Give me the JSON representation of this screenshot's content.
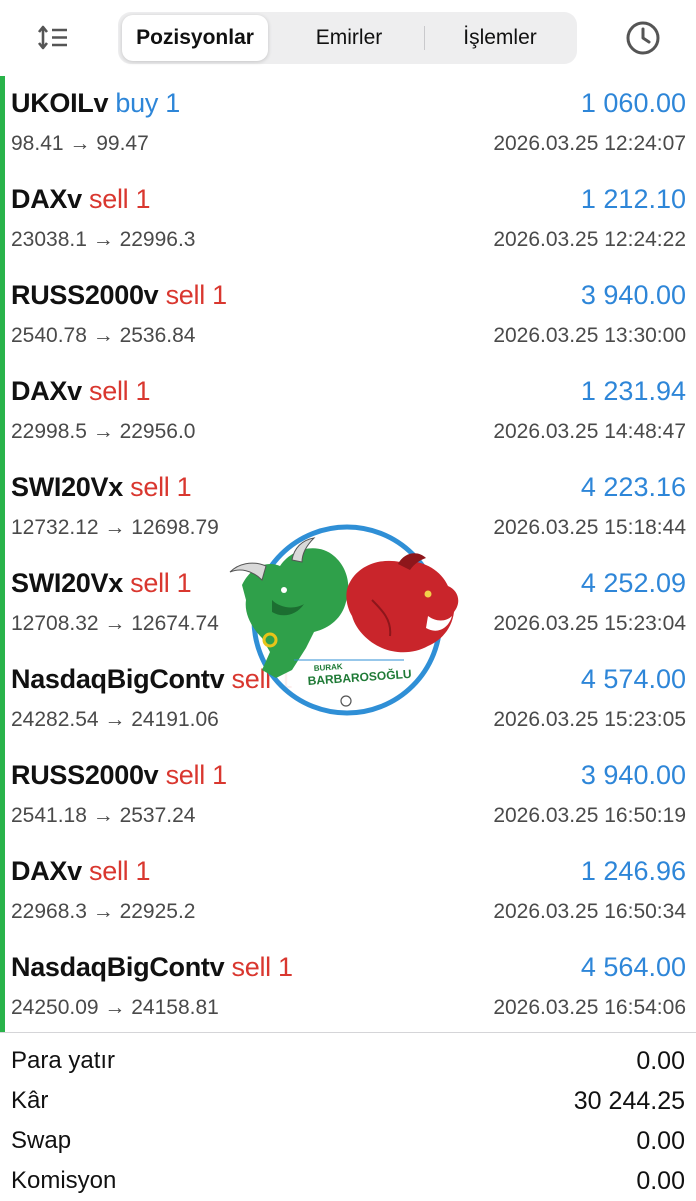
{
  "header": {
    "sort_icon": "sort-lines-icon",
    "tabs": [
      {
        "label": "Pozisyonlar",
        "active": true
      },
      {
        "label": "Emirler",
        "active": false
      },
      {
        "label": "İşlemler",
        "active": false
      }
    ],
    "history_icon": "clock-icon"
  },
  "positions": [
    {
      "symbol": "UKOILv",
      "side": "buy 1",
      "type": "buy",
      "profit": "1 060.00",
      "prices": "98.41 → 99.47",
      "time": "2026.03.25 12:24:07"
    },
    {
      "symbol": "DAXv",
      "side": "sell 1",
      "type": "sell",
      "profit": "1 212.10",
      "prices": "23038.1 → 22996.3",
      "time": "2026.03.25 12:24:22"
    },
    {
      "symbol": "RUSS2000v",
      "side": "sell 1",
      "type": "sell",
      "profit": "3 940.00",
      "prices": "2540.78 → 2536.84",
      "time": "2026.03.25 13:30:00"
    },
    {
      "symbol": "DAXv",
      "side": "sell 1",
      "type": "sell",
      "profit": "1 231.94",
      "prices": "22998.5 → 22956.0",
      "time": "2026.03.25 14:48:47"
    },
    {
      "symbol": "SWI20Vx",
      "side": "sell 1",
      "type": "sell",
      "profit": "4 223.16",
      "prices": "12732.12 → 12698.79",
      "time": "2026.03.25 15:18:44"
    },
    {
      "symbol": "SWI20Vx",
      "side": "sell 1",
      "type": "sell",
      "profit": "4 252.09",
      "prices": "12708.32 → 12674.74",
      "time": "2026.03.25 15:23:04"
    },
    {
      "symbol": "NasdaqBigContv",
      "side": "sell 1",
      "type": "sell",
      "profit": "4 574.00",
      "prices": "24282.54 → 24191.06",
      "time": "2026.03.25 15:23:05"
    },
    {
      "symbol": "RUSS2000v",
      "side": "sell 1",
      "type": "sell",
      "profit": "3 940.00",
      "prices": "2541.18 → 2537.24",
      "time": "2026.03.25 16:50:19"
    },
    {
      "symbol": "DAXv",
      "side": "sell 1",
      "type": "sell",
      "profit": "1 246.96",
      "prices": "22968.3 → 22925.2",
      "time": "2026.03.25 16:50:34"
    },
    {
      "symbol": "NasdaqBigContv",
      "side": "sell 1",
      "type": "sell",
      "profit": "4 564.00",
      "prices": "24250.09 → 24158.81",
      "time": "2026.03.25 16:54:06"
    }
  ],
  "summary": [
    {
      "label": "Para yatır",
      "value": "0.00"
    },
    {
      "label": "Kâr",
      "value": "30 244.25"
    },
    {
      "label": "Swap",
      "value": "0.00"
    },
    {
      "label": "Komisyon",
      "value": "0.00"
    }
  ],
  "watermark": {
    "line1": "BURAK",
    "line2": "BARBAROSOĞLU"
  },
  "colors": {
    "buy": "#2e86d8",
    "sell": "#d9372f",
    "profit": "#2e86d8",
    "position_bar": "#29b34a",
    "logo_ring": "#2f8fd6"
  }
}
